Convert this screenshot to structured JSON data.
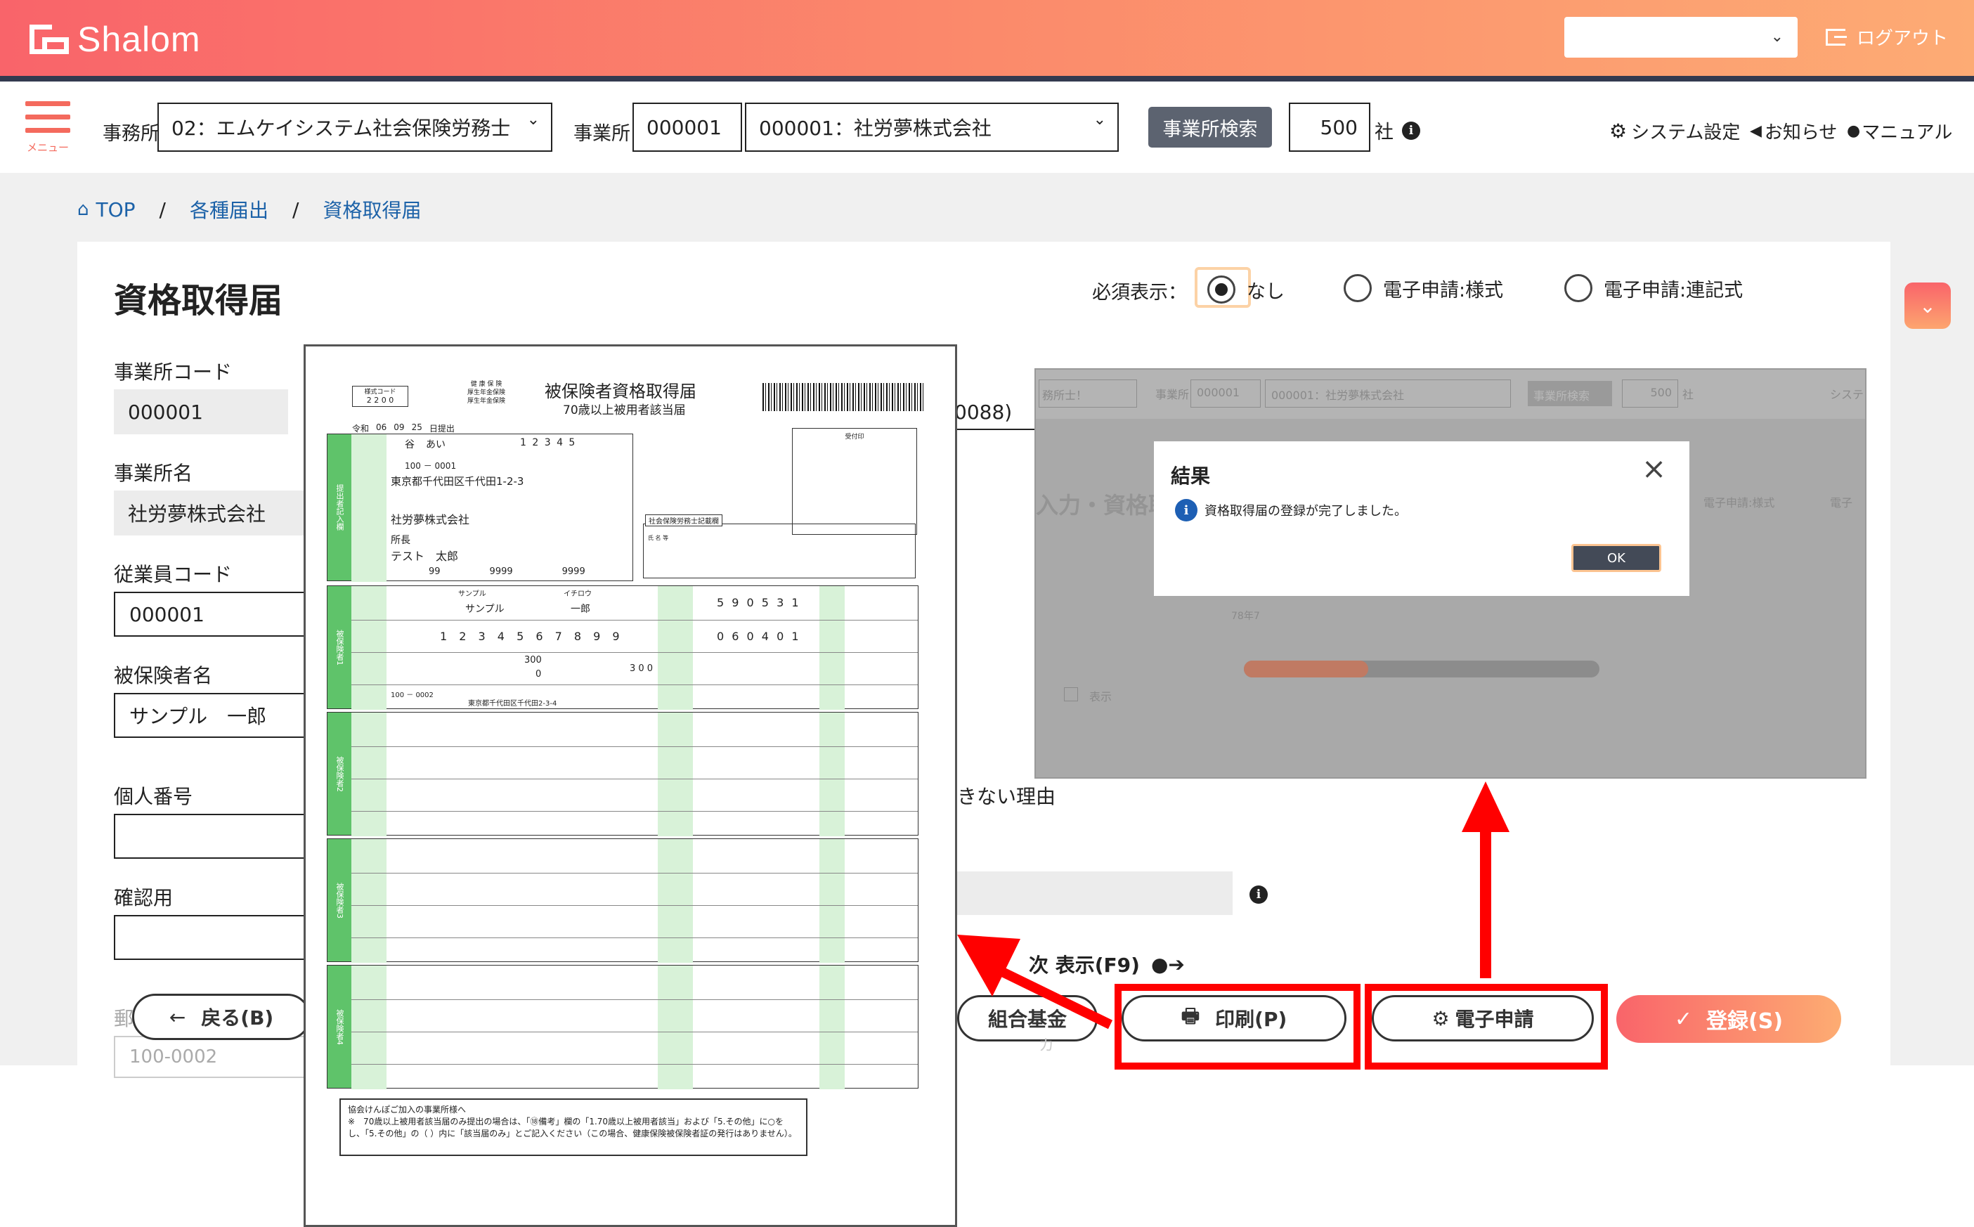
{
  "header": {
    "app_name": "Shalom",
    "logout_label": "ログアウト",
    "accent_colors": [
      "#f9646a",
      "#fdab74"
    ]
  },
  "toolbar": {
    "menu_label": "メニュー",
    "office_label": "事務所",
    "office_value": "02：エムケイシステム社会保険労務士",
    "establishment_label": "事業所",
    "establishment_code": "000001",
    "establishment_value": "000001：社労夢株式会社",
    "search_button": "事業所検索",
    "count_value": "500",
    "count_unit": "社",
    "system_settings": "システム設定",
    "notices": "お知らせ",
    "manual": "マニュアル"
  },
  "breadcrumb": {
    "top": "TOP",
    "sep": "/",
    "level1": "各種届出",
    "level2": "資格取得届"
  },
  "page": {
    "title": "資格取得届",
    "required_label": "必須表示：",
    "radio_none": "なし",
    "radio_e_form": "電子申請:様式",
    "radio_e_combined": "電子申請:連記式",
    "radio_selected": "なし"
  },
  "form": {
    "establishment_code_label": "事業所コード",
    "establishment_code_value": "000001",
    "establishment_name_label": "事業所名",
    "establishment_name_value": "社労夢株式会社",
    "employee_code_label": "従業員コード",
    "employee_code_value": "000001",
    "insured_name_label": "被保険者名",
    "insured_name_value": "サンプル　一郎",
    "personal_number_label": "個人番号",
    "confirm_label": "確認用",
    "partial_right_1": "0088)",
    "partial_right_2": "きない理由",
    "zip_prefix": "郵",
    "zip_value": "100-0002",
    "next_display": "次 表示(F9)",
    "fund_label": "組合基金",
    "partial_ka": "カ"
  },
  "buttons": {
    "back": "戻る(B)",
    "print": "印刷(P)",
    "e_apply": "電子申請",
    "register": "登録(S)"
  },
  "dialog": {
    "title": "結果",
    "message": "資格取得届の登録が完了しました。",
    "ok": "OK"
  },
  "bg_screenshot": {
    "office": "務所士！",
    "estab_label": "事業所",
    "code": "000001",
    "name": "000001：社労夢株式会社",
    "search": "事業所検索",
    "count": "500",
    "unit": "社",
    "sys": "システ",
    "title_partial": "入力・資格取得",
    "radio1": "電子申請:様式",
    "radio2": "電子",
    "small_text": "78年7",
    "check_label": "表示",
    "progress": 0.35
  },
  "paper": {
    "form_code_label": "様式コード",
    "form_code": "2 2 0 0",
    "agency_line1": "健 康 保 険",
    "agency_line2": "厚生年金保険",
    "agency_line3": "厚生年金保険",
    "title": "被保険者資格取得届",
    "subtitle": "70歳以上被用者該当届",
    "received_stamp": "受付印",
    "date_era": "令和",
    "date_year": "06",
    "date_month": "09",
    "date_day": "25",
    "date_suffix": "日提出",
    "office_code_1": "谷",
    "office_code_2": "あい",
    "office_number": "1 2 3 4 5",
    "zip": "100 － 0001",
    "address": "東京都千代田区千代田1-2-3",
    "company": "社労夢株式会社",
    "owner_title": "所長",
    "owner_name": "テスト　太郎",
    "phone_1": "99",
    "phone_2": "9999",
    "phone_3": "9999",
    "sharoushi_box": "社会保険労務士記載欄",
    "sharoushi_name": "氏 名 等",
    "side_submitter": "提出者記入欄",
    "side_insured_1": "被保険者1",
    "side_insured_2": "被保険者2",
    "side_insured_3": "被保険者3",
    "side_insured_4": "被保険者4",
    "insured_kana": "サンプル",
    "insured_kana_given": "イチロウ",
    "insured_name": "サンプル",
    "insured_given": "一郎",
    "birth_digits": "5 9 0 5 3 1",
    "mynumber_digits": "1 2 3 4 5 6 7 8 9 9",
    "acq_date_digits": "0 6 0 4 0 1",
    "salary_1": "300",
    "salary_2": "0",
    "salary_total": "3 0 0",
    "insured_zip": "100 － 0002",
    "insured_address": "東京都千代田区千代田2-3-4",
    "note_title": "協会けんぽご加入の事業所様へ",
    "note_body": "※　70歳以上被用者該当届のみ提出の場合は、「⑱備考」欄の「1.70歳以上被用者該当」および「5.その他」に○をし、「5.その他」の（ ）内に「該当届のみ」とご記入ください（この場合、健康保険被保険者証の発行はありません）。"
  }
}
